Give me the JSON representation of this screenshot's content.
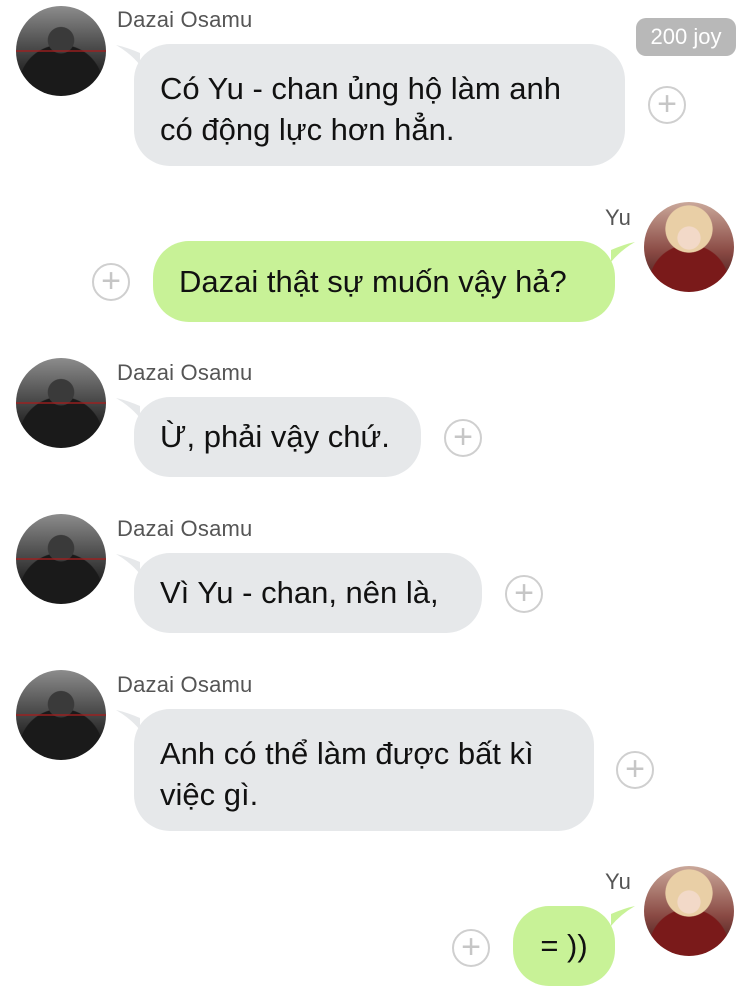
{
  "badge": {
    "text": "200 joy"
  },
  "messages": [
    {
      "sender": "Dazai Osamu",
      "side": "in",
      "text_lines": [
        "Có Yu - chan ủng hộ làm anh",
        "có động lực hơn hẳn."
      ]
    },
    {
      "sender": "Yu",
      "side": "out",
      "text_lines": [
        "Dazai thật sự muốn vậy hả?"
      ]
    },
    {
      "sender": "Dazai Osamu",
      "side": "in",
      "text_lines": [
        "Ừ, phải vậy chứ."
      ]
    },
    {
      "sender": "Dazai Osamu",
      "side": "in",
      "text_lines": [
        "Vì Yu - chan, nên là,"
      ]
    },
    {
      "sender": "Dazai Osamu",
      "side": "in",
      "text_lines": [
        "Anh có thể làm được bất kì",
        "việc gì."
      ]
    },
    {
      "sender": "Yu",
      "side": "out",
      "text_lines": [
        "= ))"
      ]
    }
  ],
  "icons": {
    "add": "plus-circle-icon",
    "avatar_dazai": "avatar-dazai",
    "avatar_yu": "avatar-yu"
  },
  "colors": {
    "incoming_bubble": "#e6e8ea",
    "outgoing_bubble": "#c8f297",
    "badge_bg": "#b8b8b8"
  }
}
